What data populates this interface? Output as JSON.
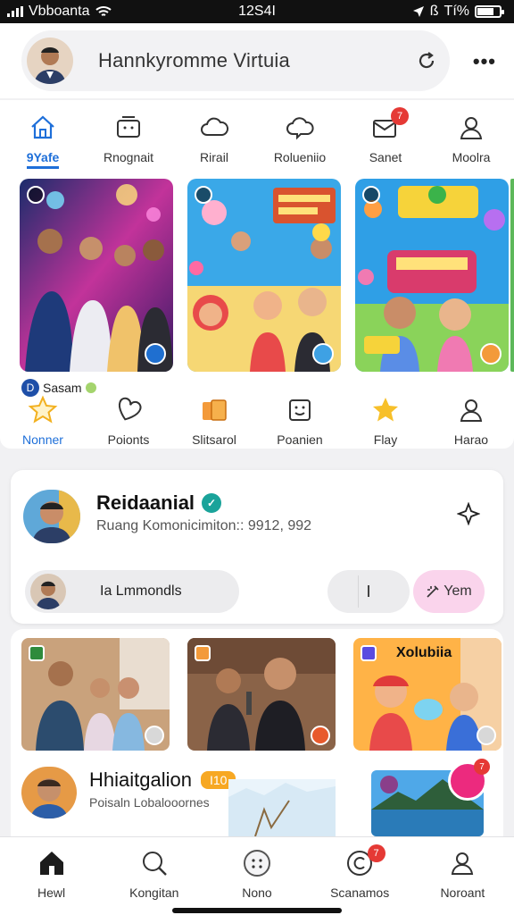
{
  "status_bar": {
    "carrier": "Vbboanta",
    "time": "12S4I",
    "battery": "Tí%"
  },
  "header": {
    "title": "Hannkyromme Virtuia",
    "avatar_icon": "user-avatar",
    "refresh_icon": "refresh-icon",
    "more_icon": "more-horizontal-icon"
  },
  "category_tabs": [
    {
      "label": "9Yafe",
      "icon": "home-icon",
      "active": true
    },
    {
      "label": "Rnognait",
      "icon": "inbox-icon"
    },
    {
      "label": "Rirail",
      "icon": "cloud-icon"
    },
    {
      "label": "Rolueniio",
      "icon": "cloud-chat-icon"
    },
    {
      "label": "Sanet",
      "icon": "mail-icon",
      "badge": "7"
    },
    {
      "label": "Moolra",
      "icon": "person-icon"
    }
  ],
  "stories": [
    {
      "label": "Story 1 — family at party",
      "corner": "d",
      "colors": [
        "#2b1855",
        "#e03f9f",
        "#38a8ff"
      ]
    },
    {
      "label": "Story 2 — kids cartoon",
      "corner": "d",
      "colors": [
        "#3aa8e8",
        "#f7c948",
        "#ff6aa3"
      ]
    },
    {
      "label": "Story 3 — colorful poster",
      "corner": "d",
      "colors": [
        "#2f9fe6",
        "#f6d33a",
        "#f07ab2"
      ]
    }
  ],
  "story_chip": {
    "label": "Sasam",
    "marker": "D"
  },
  "action_tabs": [
    {
      "label": "Nonner",
      "icon": "star-outline-icon",
      "active": true
    },
    {
      "label": "Poionts",
      "icon": "heart-icon"
    },
    {
      "label": "Slitsarol",
      "icon": "cards-icon"
    },
    {
      "label": "Poanien",
      "icon": "smile-box-icon"
    },
    {
      "label": "Flay",
      "icon": "star-filled-icon"
    },
    {
      "label": "Harao",
      "icon": "person-icon"
    }
  ],
  "profile": {
    "name": "Reidaanial",
    "verified": "✓",
    "subtitle": "Ruang Komonicimiton:: 9912, 992",
    "pill_label": "Ia Lmmondls",
    "middle_button": "I",
    "yem_button": "Yem",
    "yem_icon": "wand-icon",
    "star_icon": "sparkle-icon"
  },
  "feed": {
    "thumbs": [
      {
        "label": "Family photo",
        "colors": [
          "#b78a63",
          "#4a6f8f"
        ]
      },
      {
        "label": "Boys with microphone",
        "colors": [
          "#9c6b4a",
          "#3b2a20"
        ]
      },
      {
        "label": "Cartoon kids",
        "colors": [
          "#ffb347",
          "#ff7a45"
        ]
      }
    ],
    "thumb3_caption": "Xolubiia",
    "post_title": "Hhiaitgalion",
    "post_tag": "I10",
    "post_subtitle": "Poisaln Lobalooornes",
    "bubble_badge": "7"
  },
  "bottom_nav": [
    {
      "label": "Hewl",
      "icon": "home-filled-icon"
    },
    {
      "label": "Kongitan",
      "icon": "search-icon"
    },
    {
      "label": "Nono",
      "icon": "emoji-icon"
    },
    {
      "label": "Scanamos",
      "icon": "refresh-circle-icon",
      "badge": "7"
    },
    {
      "label": "Noroant",
      "icon": "person-icon"
    }
  ],
  "colors": {
    "accent": "#1e6fd9",
    "badge": "#e53935",
    "pink_pill": "#fad4ec",
    "verified": "#1aa39a",
    "tag": "#f7a823"
  }
}
